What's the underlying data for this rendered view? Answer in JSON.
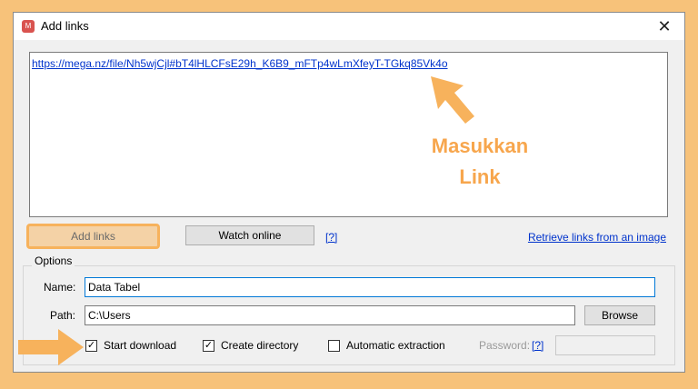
{
  "window": {
    "title": "Add links",
    "icon_text": "M",
    "close_glyph": "✕"
  },
  "links": {
    "text": "https://mega.nz/file/Nh5wjCjl#bT4lHLCFsE29h_K6B9_mFTp4wLmXfeyT-TGkq85Vk4o"
  },
  "buttons": {
    "add_links": "Add links",
    "watch_online": "Watch online",
    "help": "[?]",
    "retrieve": "Retrieve links from an image",
    "browse": "Browse"
  },
  "options": {
    "group_label": "Options",
    "name_label": "Name:",
    "name_value": "Data Tabel",
    "path_label": "Path:",
    "path_value": "C:\\Users",
    "start_download": {
      "label": "Start download",
      "checked": true
    },
    "create_directory": {
      "label": "Create directory",
      "checked": true
    },
    "automatic_extraction": {
      "label": "Automatic extraction",
      "checked": false
    },
    "password_label": "Password:",
    "password_help": "[?]",
    "password_value": ""
  },
  "annotation": {
    "line1": "Masukkan",
    "line2": "Link",
    "color": "#f7a64d"
  },
  "colors": {
    "background": "#f7c27a",
    "accent": "#f7b25c",
    "link": "#0033cc"
  }
}
